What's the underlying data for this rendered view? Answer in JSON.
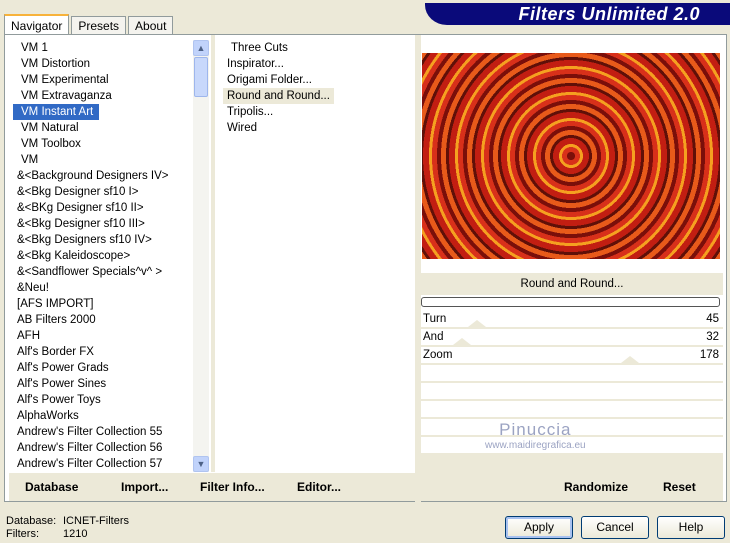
{
  "app": {
    "title": "Filters Unlimited 2.0"
  },
  "tabs": [
    {
      "label": "Navigator"
    },
    {
      "label": "Presets"
    },
    {
      "label": "About"
    }
  ],
  "categories": [
    "VM 1",
    "VM Distortion",
    "VM Experimental",
    "VM Extravaganza",
    "VM Instant Art",
    "VM Natural",
    "VM Toolbox",
    "VM",
    "&<Background Designers IV>",
    "&<Bkg Designer sf10 I>",
    "&<BKg Designer sf10 II>",
    "&<Bkg Designer sf10 III>",
    "&<Bkg Designers sf10 IV>",
    "&<Bkg Kaleidoscope>",
    "&<Sandflower Specials^v^ >",
    "&Neu!",
    "[AFS IMPORT]",
    "AB Filters 2000",
    "AFH",
    "Alf's Border FX",
    "Alf's Power Grads",
    "Alf's Power Sines",
    "Alf's Power Toys",
    "AlphaWorks",
    "Andrew's Filter Collection 55",
    "Andrew's Filter Collection 56",
    "Andrew's Filter Collection 57"
  ],
  "selected_category": "VM Instant Art",
  "filters": [
    "Three Cuts",
    "Inspirator...",
    "Origami Folder...",
    "Round and Round...",
    "Tripolis...",
    "Wired"
  ],
  "selected_filter": "Round and Round...",
  "preview": {
    "filter_name": "Round and Round...",
    "progress": 0
  },
  "params": [
    {
      "label": "Turn",
      "value": 45,
      "max": 255
    },
    {
      "label": "And",
      "value": 32,
      "max": 255
    },
    {
      "label": "Zoom",
      "value": 178,
      "max": 255
    }
  ],
  "watermark": {
    "name": "Pinuccia",
    "url": "www.maidiregrafica.eu"
  },
  "left_buttons": [
    "Database",
    "Import...",
    "Filter Info...",
    "Editor..."
  ],
  "right_buttons": [
    "Randomize",
    "Reset"
  ],
  "status": {
    "database_label": "Database:",
    "database": "ICNET-Filters",
    "filters_label": "Filters:",
    "filters": "1210"
  },
  "dialog_buttons": {
    "apply": "Apply",
    "cancel": "Cancel",
    "help": "Help"
  }
}
